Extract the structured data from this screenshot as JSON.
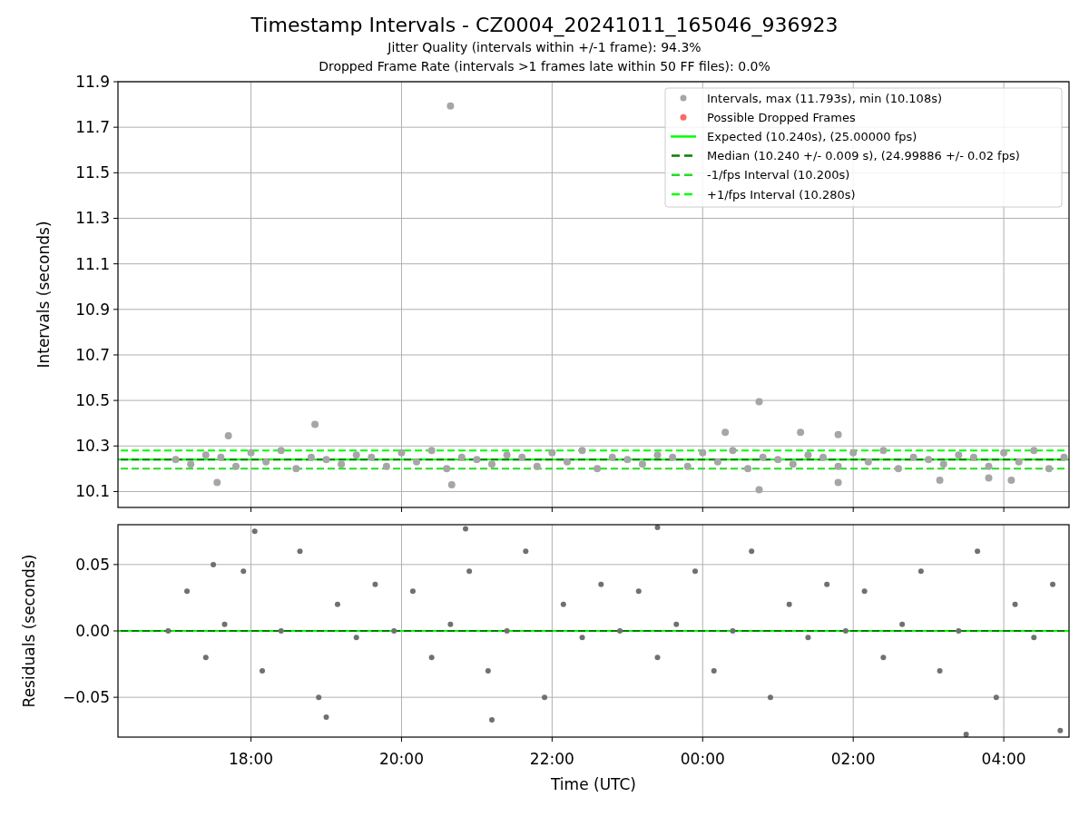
{
  "figure": {
    "title": "Timestamp Intervals - CZ0004_20241011_165046_936923",
    "subtitles": [
      "Jitter Quality (intervals within +/-1 frame): 94.3%",
      "Dropped Frame Rate (intervals >1 frames late within 50 FF files): 0.0%"
    ]
  },
  "top_chart": {
    "chart_data": {
      "type": "scatter",
      "legend": "upper right",
      "ylabel": "Intervals (seconds)",
      "grid": true,
      "xlim": [
        "2024-10-11T16:14",
        "2024-10-12T04:52"
      ],
      "ylim": [
        10.03,
        11.9
      ],
      "yticks": [
        {
          "value": 10.1,
          "label": "10.1"
        },
        {
          "value": 10.3,
          "label": "10.3"
        },
        {
          "value": 10.5,
          "label": "10.5"
        },
        {
          "value": 10.7,
          "label": "10.7"
        },
        {
          "value": 10.9,
          "label": "10.9"
        },
        {
          "value": 11.1,
          "label": "11.1"
        },
        {
          "value": 11.3,
          "label": "11.3"
        },
        {
          "value": 11.5,
          "label": "11.5"
        },
        {
          "value": 11.7,
          "label": "11.7"
        },
        {
          "value": 11.9,
          "label": "11.9"
        }
      ],
      "series": [
        {
          "name": "Intervals, max (11.793s), min (10.108s)",
          "color": "#a6a6a6",
          "x": [
            "2024-10-11T17:00",
            "2024-10-11T17:12",
            "2024-10-11T17:24",
            "2024-10-11T17:36",
            "2024-10-11T17:48",
            "2024-10-11T18:00",
            "2024-10-11T18:12",
            "2024-10-11T18:24",
            "2024-10-11T18:36",
            "2024-10-11T18:48",
            "2024-10-11T19:00",
            "2024-10-11T19:12",
            "2024-10-11T19:24",
            "2024-10-11T19:36",
            "2024-10-11T19:48",
            "2024-10-11T20:00",
            "2024-10-11T20:12",
            "2024-10-11T20:24",
            "2024-10-11T20:36",
            "2024-10-11T20:48",
            "2024-10-11T21:00",
            "2024-10-11T21:12",
            "2024-10-11T21:24",
            "2024-10-11T21:36",
            "2024-10-11T21:48",
            "2024-10-11T22:00",
            "2024-10-11T22:12",
            "2024-10-11T22:24",
            "2024-10-11T22:36",
            "2024-10-11T22:48",
            "2024-10-11T23:00",
            "2024-10-11T23:12",
            "2024-10-11T23:24",
            "2024-10-11T23:36",
            "2024-10-11T23:48",
            "2024-10-12T00:00",
            "2024-10-12T00:12",
            "2024-10-12T00:24",
            "2024-10-12T00:36",
            "2024-10-12T00:48",
            "2024-10-12T01:00",
            "2024-10-12T01:12",
            "2024-10-12T01:24",
            "2024-10-12T01:36",
            "2024-10-12T01:48",
            "2024-10-12T02:00",
            "2024-10-12T02:12",
            "2024-10-12T02:24",
            "2024-10-12T02:36",
            "2024-10-12T02:48",
            "2024-10-12T03:00",
            "2024-10-12T03:12",
            "2024-10-12T03:24",
            "2024-10-12T03:36",
            "2024-10-12T03:48",
            "2024-10-12T04:00",
            "2024-10-12T04:12",
            "2024-10-12T04:24",
            "2024-10-12T04:36",
            "2024-10-12T04:48",
            "2024-10-11T20:39",
            "2024-10-12T00:45",
            "2024-10-11T18:51",
            "2024-10-12T00:45",
            "2024-10-11T17:42",
            "2024-10-11T17:33",
            "2024-10-11T20:40",
            "2024-10-12T00:18",
            "2024-10-12T01:18",
            "2024-10-12T01:48",
            "2024-10-12T01:48",
            "2024-10-12T03:09",
            "2024-10-12T04:06",
            "2024-10-12T03:48"
          ],
          "values": [
            10.24,
            10.22,
            10.26,
            10.25,
            10.21,
            10.27,
            10.23,
            10.28,
            10.2,
            10.25,
            10.24,
            10.22,
            10.26,
            10.25,
            10.21,
            10.27,
            10.23,
            10.28,
            10.2,
            10.25,
            10.24,
            10.22,
            10.26,
            10.25,
            10.21,
            10.27,
            10.23,
            10.28,
            10.2,
            10.25,
            10.24,
            10.22,
            10.26,
            10.25,
            10.21,
            10.27,
            10.23,
            10.28,
            10.2,
            10.25,
            10.24,
            10.22,
            10.26,
            10.25,
            10.21,
            10.27,
            10.23,
            10.28,
            10.2,
            10.25,
            10.24,
            10.22,
            10.26,
            10.25,
            10.21,
            10.27,
            10.23,
            10.28,
            10.2,
            10.25,
            11.793,
            10.495,
            10.395,
            10.108,
            10.345,
            10.14,
            10.13,
            10.36,
            10.36,
            10.35,
            10.14,
            10.15,
            10.15,
            10.16
          ]
        },
        {
          "name": "Possible Dropped Frames",
          "color": "#ff6666"
        }
      ],
      "ref_lines": [
        {
          "axis": "y",
          "value": 10.24,
          "label": "Expected (10.240s), (25.00000 fps)",
          "color": "#00ff00"
        },
        {
          "axis": "y",
          "value": 10.24,
          "label": "Median (10.240 +/- 0.009 s), (24.99886 +/- 0.02 fps)",
          "color": "#008000"
        },
        {
          "axis": "y",
          "value": 10.2,
          "label": "-1/fps Interval (10.200s)",
          "color": "#22dd22"
        },
        {
          "axis": "y",
          "value": 10.28,
          "label": "+1/fps Interval (10.280s)",
          "color": "#00ff00"
        }
      ]
    }
  },
  "bottom_chart": {
    "chart_data": {
      "type": "scatter",
      "xlabel": "Time (UTC)",
      "ylabel": "Residuals (seconds)",
      "grid": true,
      "xlim": [
        "2024-10-11T16:14",
        "2024-10-12T04:52"
      ],
      "ylim": [
        -0.08,
        0.08
      ],
      "xticks": [
        {
          "value": "2024-10-11T18:00",
          "label": "18:00"
        },
        {
          "value": "2024-10-11T20:00",
          "label": "20:00"
        },
        {
          "value": "2024-10-11T22:00",
          "label": "22:00"
        },
        {
          "value": "2024-10-12T00:00",
          "label": "00:00"
        },
        {
          "value": "2024-10-12T02:00",
          "label": "02:00"
        },
        {
          "value": "2024-10-12T04:00",
          "label": "04:00"
        }
      ],
      "yticks": [
        {
          "value": -0.05,
          "label": "−0.05"
        },
        {
          "value": 0,
          "label": "0.00"
        },
        {
          "value": 0.05,
          "label": "0.05"
        }
      ],
      "series": [
        {
          "color": "#707070",
          "x": [
            "2024-10-11T16:54",
            "2024-10-11T17:09",
            "2024-10-11T17:24",
            "2024-10-11T17:39",
            "2024-10-11T17:54",
            "2024-10-11T18:09",
            "2024-10-11T18:24",
            "2024-10-11T18:39",
            "2024-10-11T18:54",
            "2024-10-11T19:09",
            "2024-10-11T19:24",
            "2024-10-11T19:39",
            "2024-10-11T19:54",
            "2024-10-11T20:09",
            "2024-10-11T20:24",
            "2024-10-11T20:39",
            "2024-10-11T20:54",
            "2024-10-11T21:09",
            "2024-10-11T21:24",
            "2024-10-11T21:39",
            "2024-10-11T21:54",
            "2024-10-11T22:09",
            "2024-10-11T22:24",
            "2024-10-11T22:39",
            "2024-10-11T22:54",
            "2024-10-11T23:09",
            "2024-10-11T23:24",
            "2024-10-11T23:39",
            "2024-10-11T23:54",
            "2024-10-12T00:09",
            "2024-10-12T00:24",
            "2024-10-12T00:39",
            "2024-10-12T00:54",
            "2024-10-12T01:09",
            "2024-10-12T01:24",
            "2024-10-12T01:39",
            "2024-10-12T01:54",
            "2024-10-12T02:09",
            "2024-10-12T02:24",
            "2024-10-12T02:39",
            "2024-10-12T02:54",
            "2024-10-12T03:09",
            "2024-10-12T03:24",
            "2024-10-12T03:39",
            "2024-10-12T03:54",
            "2024-10-12T04:09",
            "2024-10-12T04:24",
            "2024-10-12T04:39",
            "2024-10-11T17:30",
            "2024-10-11T18:03",
            "2024-10-11T19:00",
            "2024-10-11T21:12",
            "2024-10-11T23:24",
            "2024-10-12T03:30",
            "2024-10-12T04:45",
            "2024-10-11T20:51"
          ],
          "values": [
            0.0,
            0.03,
            -0.02,
            0.005,
            0.045,
            -0.03,
            0.0,
            0.06,
            -0.05,
            0.02,
            -0.005,
            0.035,
            0.0,
            0.03,
            -0.02,
            0.005,
            0.045,
            -0.03,
            0.0,
            0.06,
            -0.05,
            0.02,
            -0.005,
            0.035,
            0.0,
            0.03,
            -0.02,
            0.005,
            0.045,
            -0.03,
            0.0,
            0.06,
            -0.05,
            0.02,
            -0.005,
            0.035,
            0.0,
            0.03,
            -0.02,
            0.005,
            0.045,
            -0.03,
            0.0,
            0.06,
            -0.05,
            0.02,
            -0.005,
            0.035,
            0.05,
            0.075,
            -0.065,
            -0.067,
            0.078,
            -0.078,
            -0.075,
            0.077
          ]
        }
      ],
      "ref_lines": [
        {
          "axis": "y",
          "value": 0,
          "color": "#00ff00"
        },
        {
          "axis": "y",
          "value": 0,
          "color": "#008000"
        }
      ]
    }
  }
}
